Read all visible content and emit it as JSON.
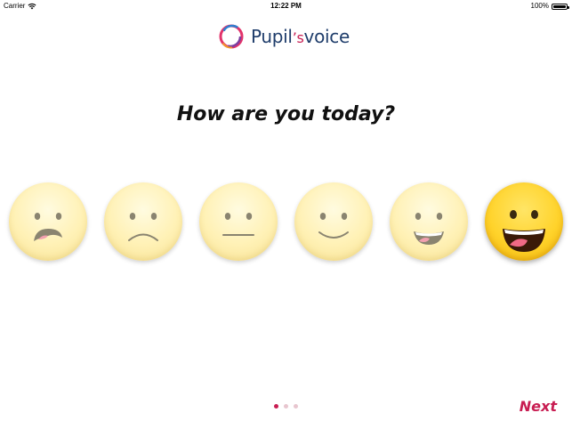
{
  "status_bar": {
    "carrier": "Carrier",
    "wifi_icon": "wifi-icon",
    "time": "12:22 PM",
    "battery": "100%",
    "battery_icon": "battery-icon"
  },
  "header": {
    "logo_icon": "pupils-voice-ring-logo",
    "logo_part1": "Pupil",
    "logo_apostrophe": "’s",
    "logo_part2": "voice"
  },
  "main": {
    "question": "How are you today?",
    "faces": [
      {
        "mood": "very-sad",
        "selected": false
      },
      {
        "mood": "sad",
        "selected": false
      },
      {
        "mood": "neutral",
        "selected": false
      },
      {
        "mood": "content",
        "selected": false
      },
      {
        "mood": "happy",
        "selected": false
      },
      {
        "mood": "very-happy",
        "selected": true
      }
    ]
  },
  "pagination": {
    "current_page": 1,
    "total_pages": 3
  },
  "footer": {
    "next_label": "Next"
  },
  "colors": {
    "accent": "#c81d52",
    "logo_text": "#1f3d6b",
    "face_light": "#fff1b5",
    "face_selected": "#ffd32b"
  }
}
